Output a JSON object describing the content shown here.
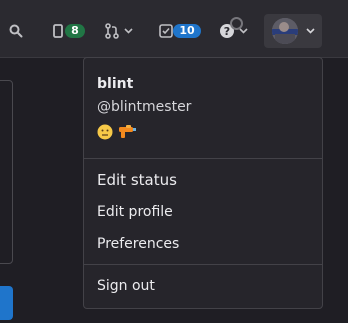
{
  "topbar": {
    "icons": [
      "search-icon",
      "issues-icon",
      "merge-request-icon",
      "todo-icon",
      "help-icon",
      "avatar"
    ],
    "issues_count": "8",
    "todos_count": "10",
    "colors": {
      "green_badge": "#217645",
      "blue_badge": "#1f75cb",
      "bar_bg": "#2b2a30"
    }
  },
  "user_menu": {
    "name": "blint",
    "username": "@blintmester",
    "status_emojis": [
      "neutral-face-emoji",
      "water-pistol-emoji"
    ],
    "items": {
      "edit_status": "Edit status",
      "edit_profile": "Edit profile",
      "preferences": "Preferences",
      "sign_out": "Sign out"
    }
  }
}
